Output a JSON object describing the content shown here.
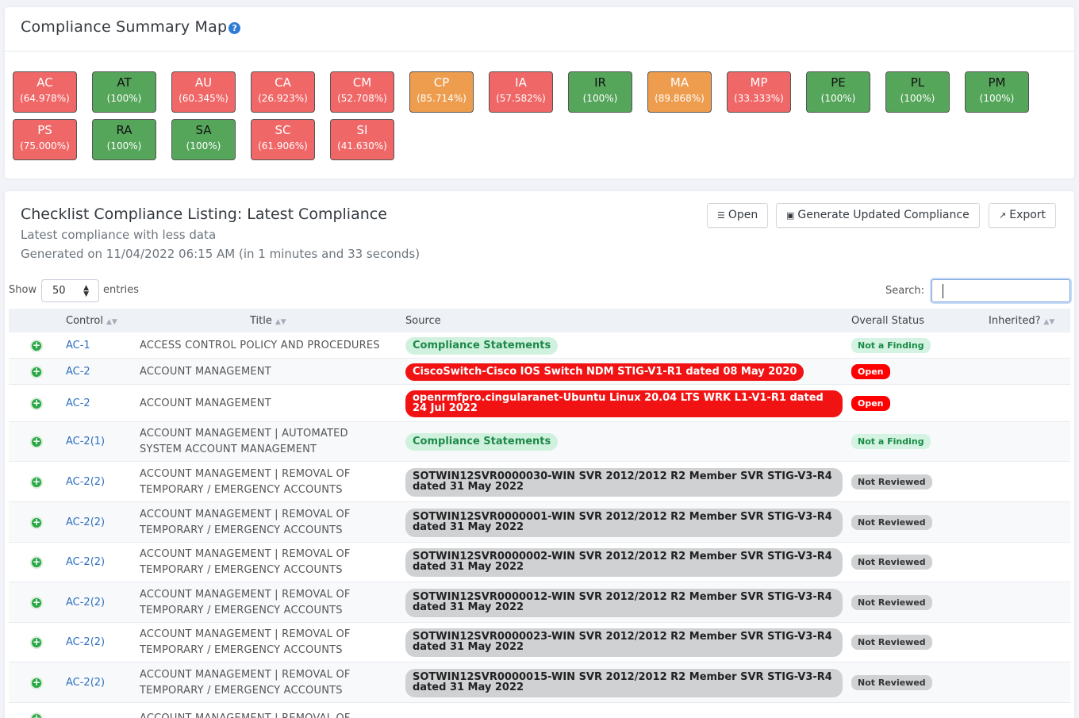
{
  "summary": {
    "title": "Compliance Summary Map",
    "help": "?",
    "tiles": [
      {
        "code": "AC",
        "pct": "(64.978%)",
        "color": "red"
      },
      {
        "code": "AT",
        "pct": "(100%)",
        "color": "green"
      },
      {
        "code": "AU",
        "pct": "(60.345%)",
        "color": "red"
      },
      {
        "code": "CA",
        "pct": "(26.923%)",
        "color": "red"
      },
      {
        "code": "CM",
        "pct": "(52.708%)",
        "color": "red"
      },
      {
        "code": "CP",
        "pct": "(85.714%)",
        "color": "orange"
      },
      {
        "code": "IA",
        "pct": "(57.582%)",
        "color": "red"
      },
      {
        "code": "IR",
        "pct": "(100%)",
        "color": "green"
      },
      {
        "code": "MA",
        "pct": "(89.868%)",
        "color": "orange"
      },
      {
        "code": "MP",
        "pct": "(33.333%)",
        "color": "red"
      },
      {
        "code": "PE",
        "pct": "(100%)",
        "color": "green"
      },
      {
        "code": "PL",
        "pct": "(100%)",
        "color": "green"
      },
      {
        "code": "PM",
        "pct": "(100%)",
        "color": "green"
      },
      {
        "code": "PS",
        "pct": "(75.000%)",
        "color": "red"
      },
      {
        "code": "RA",
        "pct": "(100%)",
        "color": "green"
      },
      {
        "code": "SA",
        "pct": "(100%)",
        "color": "green"
      },
      {
        "code": "SC",
        "pct": "(61.906%)",
        "color": "red"
      },
      {
        "code": "SI",
        "pct": "(41.630%)",
        "color": "red"
      }
    ]
  },
  "listing": {
    "title": "Checklist Compliance Listing: Latest Compliance",
    "subtitle": "Latest compliance with less data",
    "generated": "Generated on 11/04/2022 06:15 AM (in 1 minutes and 33 seconds)",
    "buttons": {
      "open": "Open",
      "generate": "Generate Updated Compliance",
      "export": "Export"
    },
    "show_label": "Show",
    "entries_value": "50",
    "entries_label": "entries",
    "search_label": "Search:",
    "search_value": "",
    "columns": {
      "control": "Control",
      "title": "Title",
      "source": "Source",
      "status": "Overall Status",
      "inherited": "Inherited?"
    },
    "rows": [
      {
        "control": "AC-1",
        "title": "ACCESS CONTROL POLICY AND PROCEDURES",
        "source": "Compliance Statements",
        "source_type": "cs",
        "status": "Not a Finding",
        "status_type": "nf"
      },
      {
        "control": "AC-2",
        "title": "ACCOUNT MANAGEMENT",
        "source": "CiscoSwitch-Cisco IOS Switch NDM STIG-V1-R1 dated 08 May 2020",
        "source_type": "red",
        "status": "Open",
        "status_type": "open"
      },
      {
        "control": "AC-2",
        "title": "ACCOUNT MANAGEMENT",
        "source": "openrmfpro.cingularanet-Ubuntu Linux 20.04 LTS WRK L1-V1-R1 dated 24 Jul 2022",
        "source_type": "red",
        "status": "Open",
        "status_type": "open"
      },
      {
        "control": "AC-2(1)",
        "title": "ACCOUNT MANAGEMENT | AUTOMATED SYSTEM ACCOUNT MANAGEMENT",
        "source": "Compliance Statements",
        "source_type": "cs",
        "status": "Not a Finding",
        "status_type": "nf"
      },
      {
        "control": "AC-2(2)",
        "title": "ACCOUNT MANAGEMENT | REMOVAL OF TEMPORARY / EMERGENCY ACCOUNTS",
        "source": "SOTWIN12SVR0000030-WIN SVR 2012/2012 R2 Member SVR STIG-V3-R4 dated 31 May 2022",
        "source_type": "gray",
        "status": "Not Reviewed",
        "status_type": "nr"
      },
      {
        "control": "AC-2(2)",
        "title": "ACCOUNT MANAGEMENT | REMOVAL OF TEMPORARY / EMERGENCY ACCOUNTS",
        "source": "SOTWIN12SVR0000001-WIN SVR 2012/2012 R2 Member SVR STIG-V3-R4 dated 31 May 2022",
        "source_type": "gray",
        "status": "Not Reviewed",
        "status_type": "nr"
      },
      {
        "control": "AC-2(2)",
        "title": "ACCOUNT MANAGEMENT | REMOVAL OF TEMPORARY / EMERGENCY ACCOUNTS",
        "source": "SOTWIN12SVR0000002-WIN SVR 2012/2012 R2 Member SVR STIG-V3-R4 dated 31 May 2022",
        "source_type": "gray",
        "status": "Not Reviewed",
        "status_type": "nr"
      },
      {
        "control": "AC-2(2)",
        "title": "ACCOUNT MANAGEMENT | REMOVAL OF TEMPORARY / EMERGENCY ACCOUNTS",
        "source": "SOTWIN12SVR0000012-WIN SVR 2012/2012 R2 Member SVR STIG-V3-R4 dated 31 May 2022",
        "source_type": "gray",
        "status": "Not Reviewed",
        "status_type": "nr"
      },
      {
        "control": "AC-2(2)",
        "title": "ACCOUNT MANAGEMENT | REMOVAL OF TEMPORARY / EMERGENCY ACCOUNTS",
        "source": "SOTWIN12SVR0000023-WIN SVR 2012/2012 R2 Member SVR STIG-V3-R4 dated 31 May 2022",
        "source_type": "gray",
        "status": "Not Reviewed",
        "status_type": "nr"
      },
      {
        "control": "AC-2(2)",
        "title": "ACCOUNT MANAGEMENT | REMOVAL OF TEMPORARY / EMERGENCY ACCOUNTS",
        "source": "SOTWIN12SVR0000015-WIN SVR 2012/2012 R2 Member SVR STIG-V3-R4 dated 31 May 2022",
        "source_type": "gray",
        "status": "Not Reviewed",
        "status_type": "nr"
      },
      {
        "control": "",
        "title": "ACCOUNT MANAGEMENT | REMOVAL OF",
        "source": "",
        "source_type": "gray",
        "status": "",
        "status_type": "nr"
      }
    ]
  }
}
